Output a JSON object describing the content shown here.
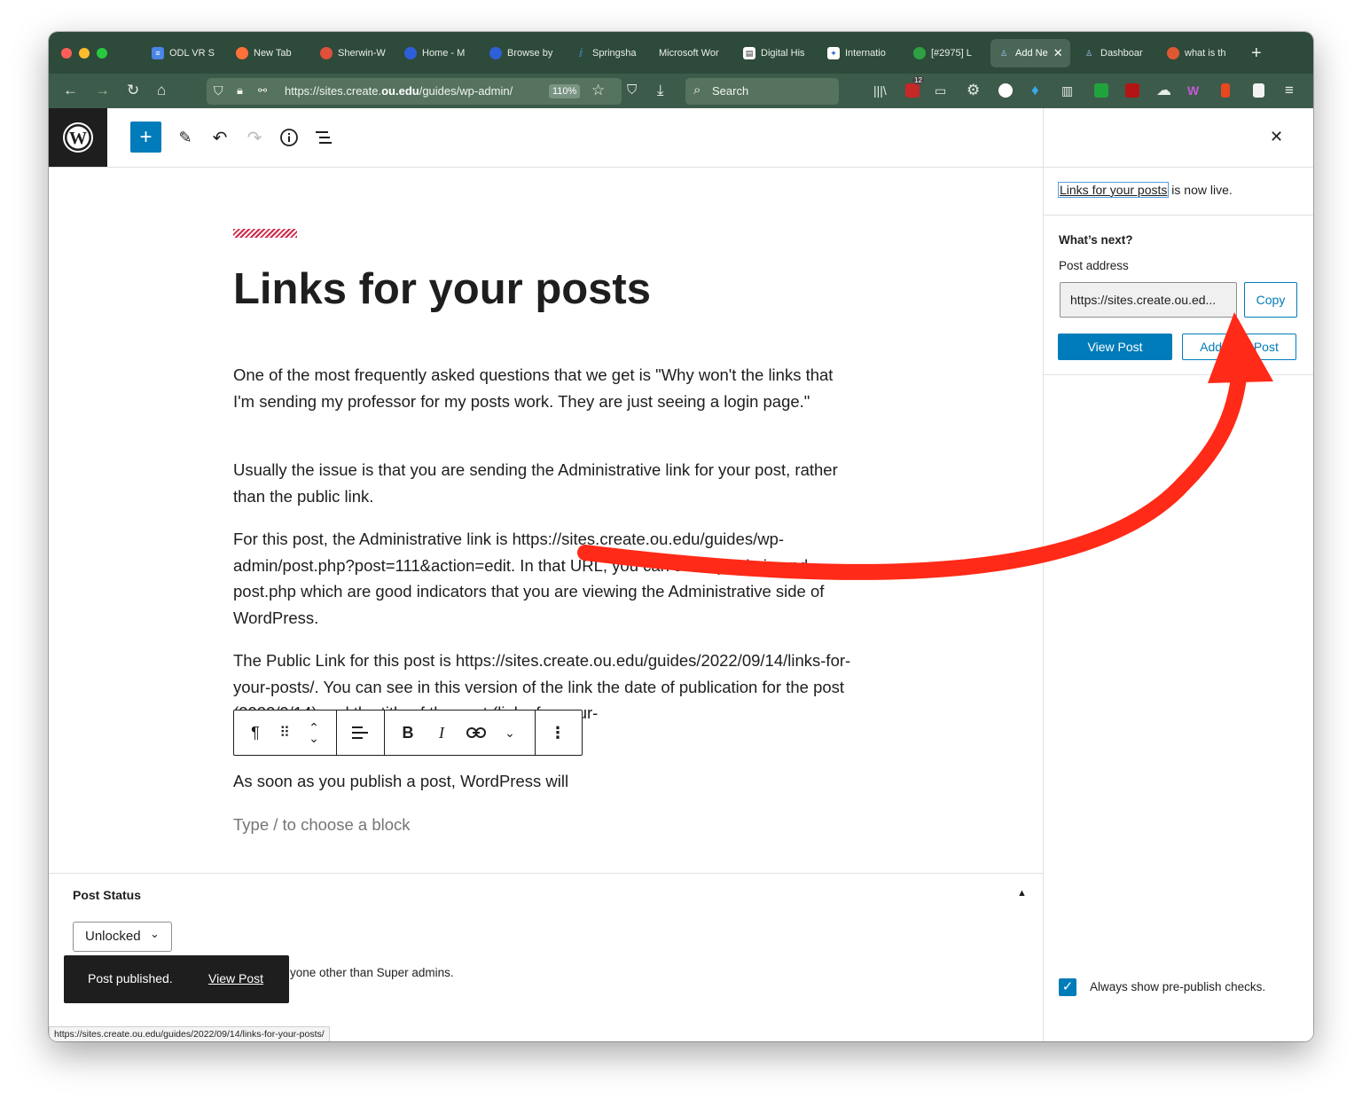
{
  "browser": {
    "tabs": [
      {
        "label": "ODL VR S",
        "icon": "docs-icon",
        "color": "#4a86e8"
      },
      {
        "label": "New Tab",
        "icon": "firefox-icon",
        "color": "#ff7139"
      },
      {
        "label": "Sherwin-W",
        "icon": "sherwin-icon",
        "color": "#e0503a"
      },
      {
        "label": "Home - M",
        "icon": "moon-icon",
        "color": "#2f5fd6"
      },
      {
        "label": "Browse by",
        "icon": "moon-icon",
        "color": "#2f5fd6"
      },
      {
        "label": "Springsha",
        "icon": "springshare-icon",
        "color": "#3d8fd8"
      },
      {
        "label": "Microsoft Wor",
        "icon": "",
        "color": ""
      },
      {
        "label": "Digital His",
        "icon": "digital-history-icon",
        "color": "#ffffff"
      },
      {
        "label": "Internatio",
        "icon": "international-icon",
        "color": "#2b6cc4"
      },
      {
        "label": "[#2975] L",
        "icon": "ticket-icon",
        "color": "#2ea043"
      },
      {
        "label": "Add Ne",
        "icon": "wp-people-icon",
        "color": "#4e90d9",
        "active": true
      },
      {
        "label": "Dashboar",
        "icon": "wp-people-icon",
        "color": "#4e90d9"
      },
      {
        "label": "what is th",
        "icon": "duckduckgo-icon",
        "color": "#de5833"
      }
    ],
    "url_prefix": "https://sites.create.",
    "url_host": "ou.edu",
    "url_suffix": "/guides/wp-admin/",
    "zoom": "110%",
    "search_placeholder": "Search",
    "badge_count": "12"
  },
  "editor": {
    "kicker": "/////////////////",
    "title": "Links for your posts",
    "paragraphs": [
      "One of the most frequently asked questions that we get is \"Why won't the links that I'm sending my professor for my posts work. They are just seeing a login page.\"",
      "Usually the issue is that you are sending the Administrative link for your post, rather than the public link.",
      "For this post, the Administrative link is https://sites.create.ou.edu/guides/wp-admin/post.php?post=111&action=edit. In that URL, you can see wp-admin and post.php which are good indicators that you are viewing the Administrative side of WordPress.",
      "The Public Link for this post is https://sites.create.ou.edu/guides/2022/09/14/links-for-your-posts/. You can see in this version of the link the date of publication for the post (2022/9/14) and the title of the post (links-for-your-"
    ],
    "last_paragraph": "As soon as you publish a post, WordPress will",
    "block_placeholder": "Type / to choose a block"
  },
  "metabox": {
    "title": "Post Status",
    "select_value": "Unlocked",
    "note": "yone other than Super admins."
  },
  "snackbar": {
    "message": "Post published.",
    "action": "View Post"
  },
  "status_url": "https://sites.create.ou.edu/guides/2022/09/14/links-for-your-posts/",
  "sidebar": {
    "post_link": "Links for your posts",
    "live_suffix": " is now live.",
    "whats_next": "What’s next?",
    "address_label": "Post address",
    "address_value": "https://sites.create.ou.ed...",
    "copy": "Copy",
    "view_post": "View Post",
    "add_new": "Add New Post",
    "checkbox_label": "Always show pre-publish checks."
  },
  "colors": {
    "wp_blue": "#007cba",
    "annotation_red": "#ff2a17",
    "browser_dark": "#2e4a3a"
  }
}
